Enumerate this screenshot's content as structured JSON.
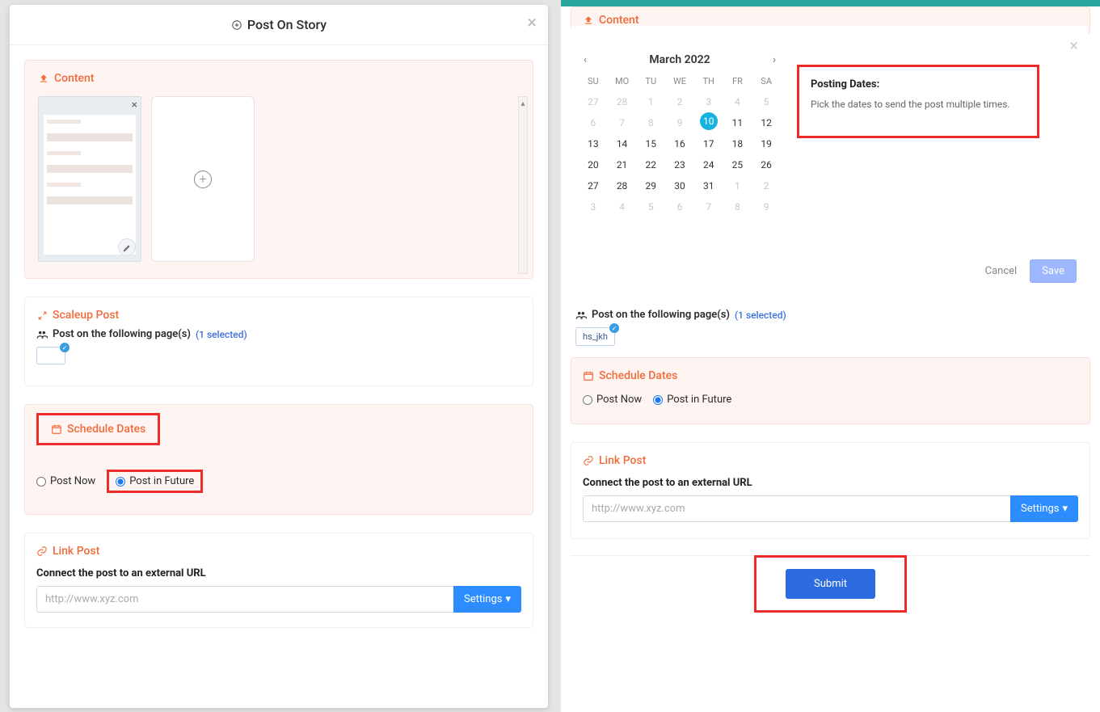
{
  "left": {
    "modal_title": "Post On Story",
    "content": {
      "title": "Content"
    },
    "scaleup": {
      "title": "Scaleup Post",
      "pages_label": "Post on the following page(s)",
      "selected_text": "(1 selected)"
    },
    "schedule": {
      "title": "Schedule Dates",
      "post_now": "Post Now",
      "post_future": "Post in Future"
    },
    "linkpost": {
      "title": "Link Post",
      "connect_label": "Connect the post to an external URL",
      "placeholder": "http://www.xyz.com",
      "settings": "Settings"
    }
  },
  "right": {
    "content_title": "Content",
    "calendar": {
      "month": "March 2022",
      "dow": [
        "SU",
        "MO",
        "TU",
        "WE",
        "TH",
        "FR",
        "SA"
      ],
      "leading_mute": [
        27,
        28,
        1,
        2,
        3,
        4,
        5,
        6,
        7,
        8,
        9
      ],
      "selected": 10,
      "normal": [
        11,
        12,
        13,
        14,
        15,
        16,
        17,
        18,
        19,
        20,
        21,
        22,
        23,
        24,
        25,
        26,
        27,
        28,
        29,
        30,
        31
      ],
      "trailing_mute": [
        1,
        2,
        3,
        4,
        5,
        6,
        7,
        8,
        9
      ],
      "info_title": "Posting Dates:",
      "info_text": "Pick the dates to send the post multiple times.",
      "cancel": "Cancel",
      "save": "Save"
    },
    "pages": {
      "label": "Post on the following page(s)",
      "selected_text": "(1 selected)",
      "chip": "hs_jkh"
    },
    "schedule": {
      "title": "Schedule Dates",
      "post_now": "Post Now",
      "post_future": "Post in Future"
    },
    "linkpost": {
      "title": "Link Post",
      "connect_label": "Connect the post to an external URL",
      "placeholder": "http://www.xyz.com",
      "settings": "Settings"
    },
    "submit": "Submit"
  }
}
